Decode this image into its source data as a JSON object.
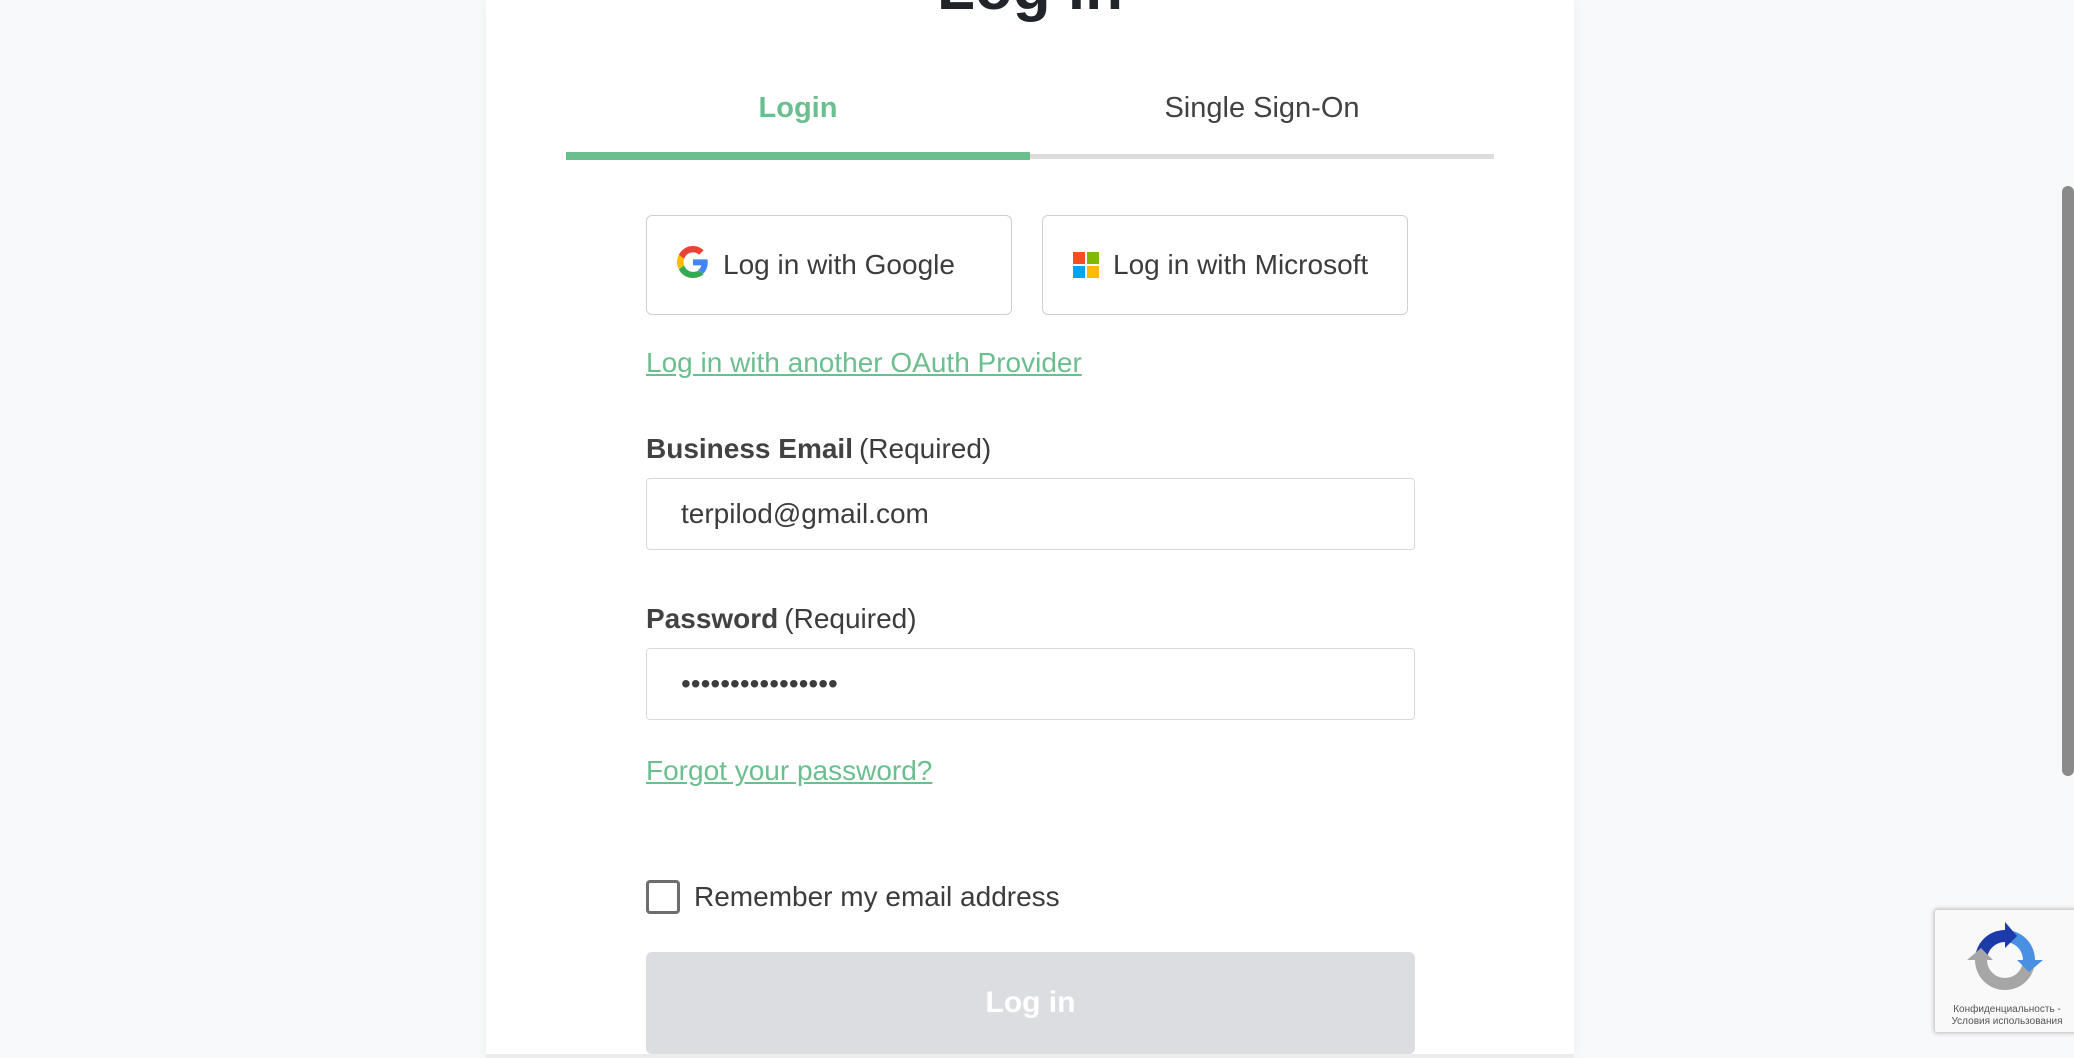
{
  "page": {
    "heading": "Log in"
  },
  "tabs": [
    {
      "label": "Login",
      "active": true
    },
    {
      "label": "Single Sign-On",
      "active": false
    }
  ],
  "oauth": {
    "google_label": "Log in with Google",
    "microsoft_label": "Log in with Microsoft",
    "other_provider_link": "Log in with another OAuth Provider"
  },
  "email_field": {
    "label": "Business Email",
    "required_note": "(Required)",
    "value": "terpilod@gmail.com"
  },
  "password_field": {
    "label": "Password",
    "required_note": "(Required)",
    "value": "••••••••••••••••"
  },
  "forgot_password_link": "Forgot your password?",
  "remember": {
    "label": "Remember my email address",
    "checked": false
  },
  "submit_label": "Log in",
  "recaptcha": {
    "privacy": "Конфиденциальность",
    "separator": "-",
    "terms": "Условия использования"
  },
  "colors": {
    "accent": "#6bbf8e",
    "disabled_button": "#dcdde0",
    "google_blue": "#4285F4",
    "google_red": "#EA4335",
    "google_yellow": "#FBBC05",
    "google_green": "#34A853",
    "ms_red": "#F25022",
    "ms_green": "#7FBA00",
    "ms_blue": "#00A4EF",
    "ms_yellow": "#FFB900"
  },
  "icons": {
    "google": "google-logo-icon",
    "microsoft": "microsoft-logo-icon",
    "recaptcha": "recaptcha-logo-icon"
  }
}
